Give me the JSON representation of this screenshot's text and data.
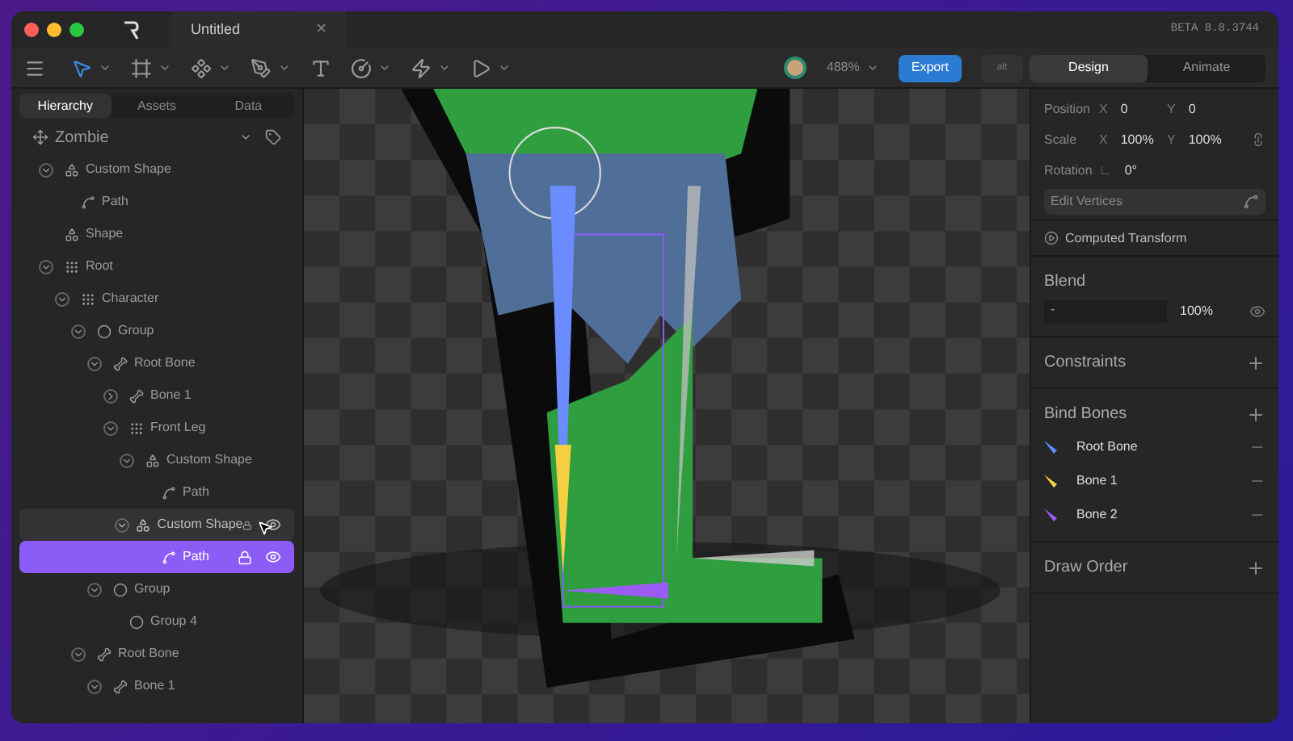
{
  "window": {
    "title": "Untitled",
    "close_glyph": "×",
    "version": "BETA 8.8.3744"
  },
  "toolbar": {
    "tools": [
      {
        "kind": "select",
        "selected": true,
        "menu": true
      },
      {
        "kind": "frame",
        "selected": false,
        "menu": true
      },
      {
        "kind": "vertices",
        "selected": false,
        "menu": true
      },
      {
        "kind": "pen",
        "selected": false,
        "menu": true
      },
      {
        "kind": "text",
        "selected": false,
        "menu": false
      },
      {
        "kind": "shape",
        "selected": false,
        "menu": true
      },
      {
        "kind": "bolt",
        "selected": false,
        "menu": true
      },
      {
        "kind": "play",
        "selected": false,
        "menu": true
      }
    ],
    "zoom": "488%",
    "export": "Export",
    "alt": "alt",
    "modes": [
      {
        "label": "Design",
        "selected": true
      },
      {
        "label": "Animate",
        "selected": false
      }
    ]
  },
  "left_panel": {
    "tabs": [
      {
        "label": "Hierarchy",
        "selected": true
      },
      {
        "label": "Assets",
        "selected": false
      },
      {
        "label": "Data",
        "selected": false
      }
    ],
    "artboard": "Zombie",
    "tree": [
      {
        "name": "Custom Shape",
        "kind": "shape",
        "expanded": true,
        "selected": false,
        "hovered": false,
        "children": [
          {
            "name": "Path",
            "kind": "path",
            "selected": false,
            "hovered": false
          }
        ]
      },
      {
        "name": "Shape",
        "kind": "shape",
        "selected": false,
        "hovered": false
      },
      {
        "name": "Root",
        "kind": "node",
        "expanded": true,
        "selected": false,
        "hovered": false,
        "children": [
          {
            "name": "Character",
            "kind": "node",
            "expanded": true,
            "selected": false,
            "hovered": false,
            "children": [
              {
                "name": "Group",
                "kind": "group",
                "expanded": true,
                "selected": false,
                "hovered": false,
                "children": [
                  {
                    "name": "Root Bone",
                    "kind": "bone",
                    "expanded": true,
                    "selected": false,
                    "hovered": false,
                    "children": [
                      {
                        "name": "Bone 1",
                        "kind": "bone",
                        "expanded": false,
                        "selected": false,
                        "hovered": false
                      },
                      {
                        "name": "Front Leg",
                        "kind": "node",
                        "expanded": true,
                        "selected": false,
                        "hovered": false,
                        "children": [
                          {
                            "name": "Custom Shape",
                            "kind": "shape",
                            "expanded": true,
                            "selected": false,
                            "hovered": false,
                            "children": [
                              {
                                "name": "Path",
                                "kind": "path",
                                "selected": false,
                                "hovered": false
                              }
                            ]
                          },
                          {
                            "name": "Custom Shape",
                            "kind": "shape",
                            "expanded": true,
                            "selected": false,
                            "hovered": true,
                            "children": [
                              {
                                "name": "Path",
                                "kind": "path",
                                "selected": true,
                                "hovered": false
                              }
                            ]
                          }
                        ]
                      }
                    ]
                  },
                  {
                    "name": "Group",
                    "kind": "group",
                    "expanded": true,
                    "selected": false,
                    "hovered": false,
                    "children": [
                      {
                        "name": "Group 4",
                        "kind": "group",
                        "selected": false,
                        "hovered": false
                      }
                    ]
                  }
                ]
              },
              {
                "name": "Root Bone",
                "kind": "bone",
                "expanded": true,
                "selected": false,
                "hovered": false,
                "children": [
                  {
                    "name": "Bone 1",
                    "kind": "bone",
                    "expanded": true,
                    "selected": false,
                    "hovered": false
                  }
                ]
              }
            ]
          }
        ]
      }
    ]
  },
  "properties": {
    "transform": [
      {
        "label": "Position",
        "fields": [
          {
            "axis": "X",
            "value": "0"
          },
          {
            "axis": "Y",
            "value": "0"
          }
        ],
        "link": false
      },
      {
        "label": "Scale",
        "fields": [
          {
            "axis": "X",
            "value": "100%"
          },
          {
            "axis": "Y",
            "value": "100%"
          }
        ],
        "link": true
      },
      {
        "label": "Rotation",
        "fields": [
          {
            "axis": "∟",
            "value": "0°"
          }
        ],
        "link": false
      }
    ],
    "edit_vertices": "Edit Vertices",
    "computed_transform": "Computed Transform",
    "blend": {
      "title": "Blend",
      "mode": "-",
      "opacity": "100%"
    },
    "constraints": "Constraints",
    "bind_bones": {
      "title": "Bind Bones",
      "bones": [
        {
          "name": "Root Bone",
          "color": "#5b8cff"
        },
        {
          "name": "Bone 1",
          "color": "#f5d142"
        },
        {
          "name": "Bone 2",
          "color": "#9b5cf6"
        }
      ]
    },
    "draw_order": "Draw Order"
  }
}
